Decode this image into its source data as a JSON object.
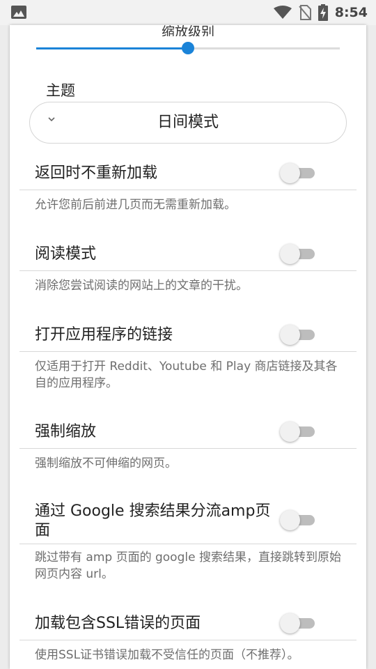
{
  "status_bar": {
    "time": "8:54",
    "icons": [
      "image-icon",
      "wifi-icon",
      "no-sim-icon",
      "battery-charging-icon"
    ]
  },
  "zoom": {
    "label": "缩放级别",
    "level_fraction": 0.5,
    "accent_color": "#1a83d8"
  },
  "theme": {
    "label": "主题",
    "selected": "日间模式",
    "icon": "chevron-down-icon"
  },
  "settings": [
    {
      "title": "返回时不重新加载",
      "description": "允许您前后前进几页而无需重新加载。",
      "enabled": false
    },
    {
      "title": "阅读模式",
      "description": "消除您尝试阅读的网站上的文章的干扰。",
      "enabled": false
    },
    {
      "title": "打开应用程序的链接",
      "description": "仅适用于打开 Reddit、Youtube 和 Play 商店链接及其各自的应用程序。",
      "enabled": false
    },
    {
      "title": "强制缩放",
      "description": "强制缩放不可伸缩的网页。",
      "enabled": false
    },
    {
      "title": "通过 Google 搜索结果分流amp页面",
      "description": "跳过带有 amp 页面的 google 搜索结果，直接跳转到原始网页内容 url。",
      "enabled": false
    },
    {
      "title": "加载包含SSL错误的页面",
      "description": "使用SSL证书错误加载不受信任的页面（不推荐）。",
      "enabled": false
    }
  ]
}
